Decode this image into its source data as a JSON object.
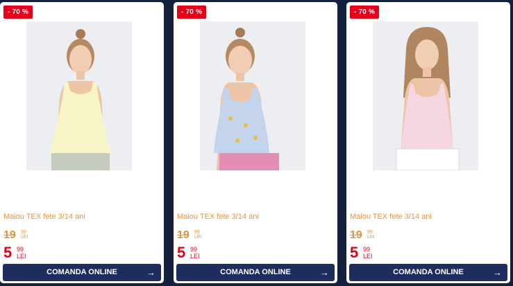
{
  "products": [
    {
      "discount_badge": "- 70 %",
      "title": "Maiou TEX fete 3/14 ani",
      "old_price_int": "19",
      "old_price_dec": "99",
      "old_price_currency": "LEI",
      "new_price_int": "5",
      "new_price_dec": "99",
      "new_price_currency": "LEI",
      "cta_label": "COMANDA ONLINE",
      "cta_icon": "arrow-right-icon"
    },
    {
      "discount_badge": "- 70 %",
      "title": "Maiou TEX fete 3/14 ani",
      "old_price_int": "19",
      "old_price_dec": "99",
      "old_price_currency": "LEI",
      "new_price_int": "5",
      "new_price_dec": "99",
      "new_price_currency": "LEI",
      "cta_label": "COMANDA ONLINE",
      "cta_icon": "arrow-right-icon"
    },
    {
      "discount_badge": "- 70 %",
      "title": "Maiou TEX fete 3/14 ani",
      "old_price_int": "19",
      "old_price_dec": "99",
      "old_price_currency": "LEI",
      "new_price_int": "5",
      "new_price_dec": "99",
      "new_price_currency": "LEI",
      "cta_label": "COMANDA ONLINE",
      "cta_icon": "arrow-right-icon"
    }
  ],
  "colors": {
    "page_background": "#14213d",
    "badge": "#e3001b",
    "title_orange": "#e8923a",
    "price_red": "#e3001b",
    "button": "#1e2d5e"
  }
}
